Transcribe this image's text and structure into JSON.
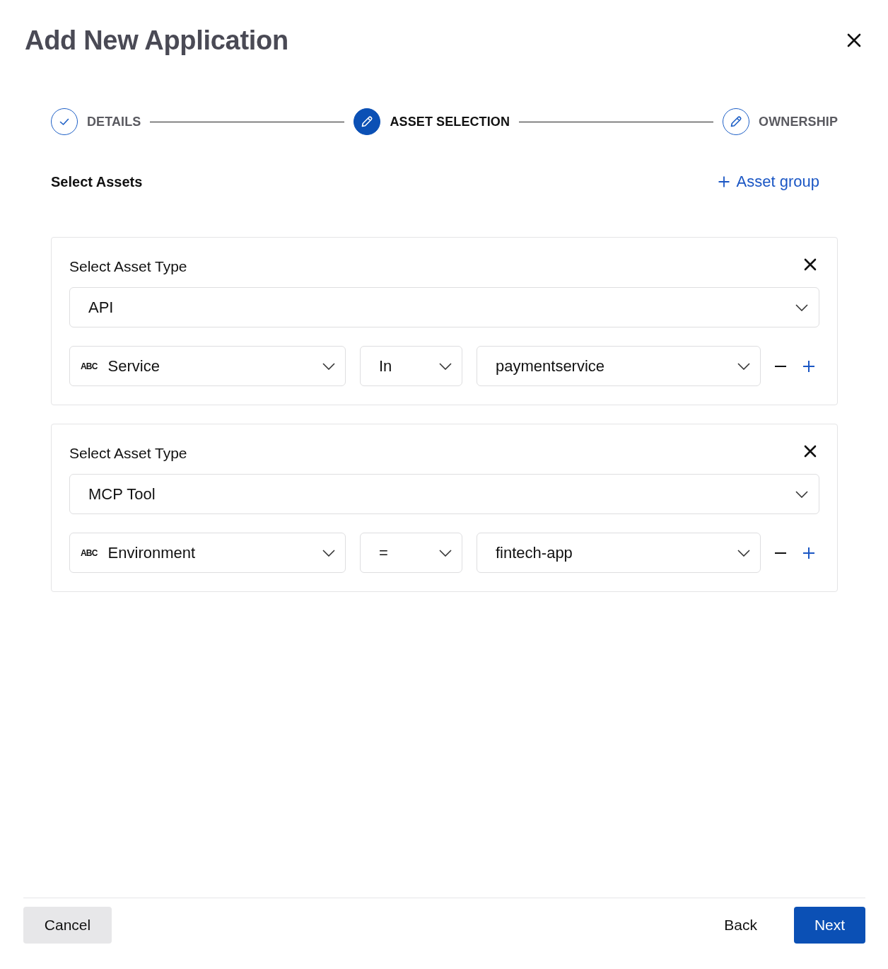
{
  "dialog": {
    "title": "Add New Application"
  },
  "steps": [
    {
      "label": "DETAILS",
      "completed": true,
      "selected": false
    },
    {
      "label": "ASSET SELECTION",
      "completed": false,
      "selected": true
    },
    {
      "label": "OWNERSHIP",
      "completed": false,
      "selected": false
    }
  ],
  "section": {
    "title": "Select Assets",
    "add_button": "Asset group"
  },
  "asset_groups": [
    {
      "label": "Select Asset Type",
      "asset_type": "API",
      "filters": [
        {
          "type_icon": "ABC",
          "field": "Service",
          "operator": "In",
          "value": "paymentservice"
        }
      ]
    },
    {
      "label": "Select Asset Type",
      "asset_type": "MCP Tool",
      "filters": [
        {
          "type_icon": "ABC",
          "field": "Environment",
          "operator": "=",
          "value": "fintech-app"
        }
      ]
    }
  ],
  "footer": {
    "cancel": "Cancel",
    "back": "Back",
    "next": "Next"
  }
}
